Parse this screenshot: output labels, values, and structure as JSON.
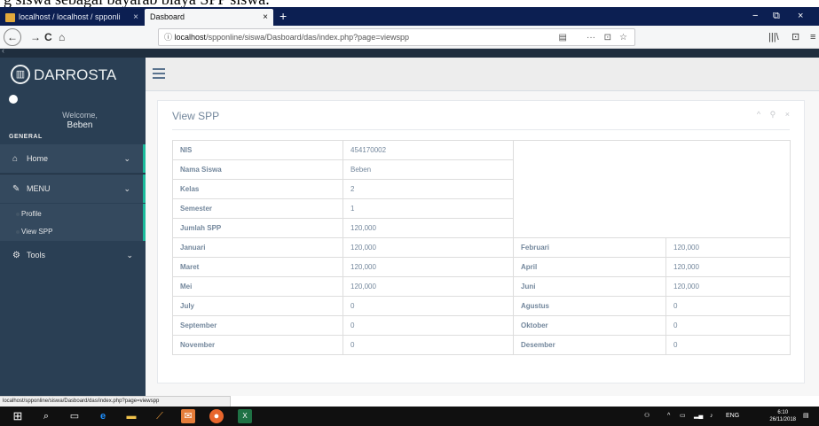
{
  "caption": "g siswa sebagai bayarab biaya SPP siswa.",
  "browser": {
    "tabs": [
      {
        "label": "localhost / localhost / spponli"
      },
      {
        "label": "Dasboard"
      }
    ],
    "url_prefix": "localhost",
    "url_rest": "/spponline/siswa/Dasboard/das/index.php?page=viewspp",
    "status_url": "localhost/spponline/siswa/Dasboard/das/index.php?page=viewspp",
    "icons": {
      "close": "×",
      "new_tab": "+",
      "minimize": "−",
      "maximize": "⧉",
      "back": "←",
      "forward": "→",
      "reload": "C",
      "home": "⌂",
      "info": "ⓘ",
      "reader": "▤",
      "more": "···",
      "pocket": "⊡",
      "star": "☆",
      "library": "|||\\",
      "sidebar": "⊡",
      "menu": "≡"
    }
  },
  "sidebar": {
    "brand": "DARROSTA",
    "welcome": "Welcome,",
    "username": "Beben",
    "section": "GENERAL",
    "home": "Home",
    "menu": "MENU",
    "profile": "Profile",
    "view_spp": "View SPP",
    "tools": "Tools",
    "chevron": "⌄"
  },
  "panel": {
    "title": "View SPP",
    "tools": "^ ⚲ ×"
  },
  "info_rows": [
    {
      "label": "NIS",
      "value": "454170002"
    },
    {
      "label": "Nama Siswa",
      "value": "Beben"
    },
    {
      "label": "Kelas",
      "value": "2"
    },
    {
      "label": "Semester",
      "value": "1"
    },
    {
      "label": "Jumlah SPP",
      "value": "120,000"
    }
  ],
  "month_rows": [
    {
      "m1": "Januari",
      "v1": "120,000",
      "m2": "Februari",
      "v2": "120,000"
    },
    {
      "m1": "Maret",
      "v1": "120,000",
      "m2": "April",
      "v2": "120,000"
    },
    {
      "m1": "Mei",
      "v1": "120,000",
      "m2": "Juni",
      "v2": "120,000"
    },
    {
      "m1": "July",
      "v1": "0",
      "m2": "Agustus",
      "v2": "0"
    },
    {
      "m1": "September",
      "v1": "0",
      "m2": "Oktober",
      "v2": "0"
    },
    {
      "m1": "November",
      "v1": "0",
      "m2": "Desember",
      "v2": "0"
    }
  ],
  "taskbar": {
    "lang": "ENG",
    "time": "6:10",
    "date": "26/11/2018"
  }
}
